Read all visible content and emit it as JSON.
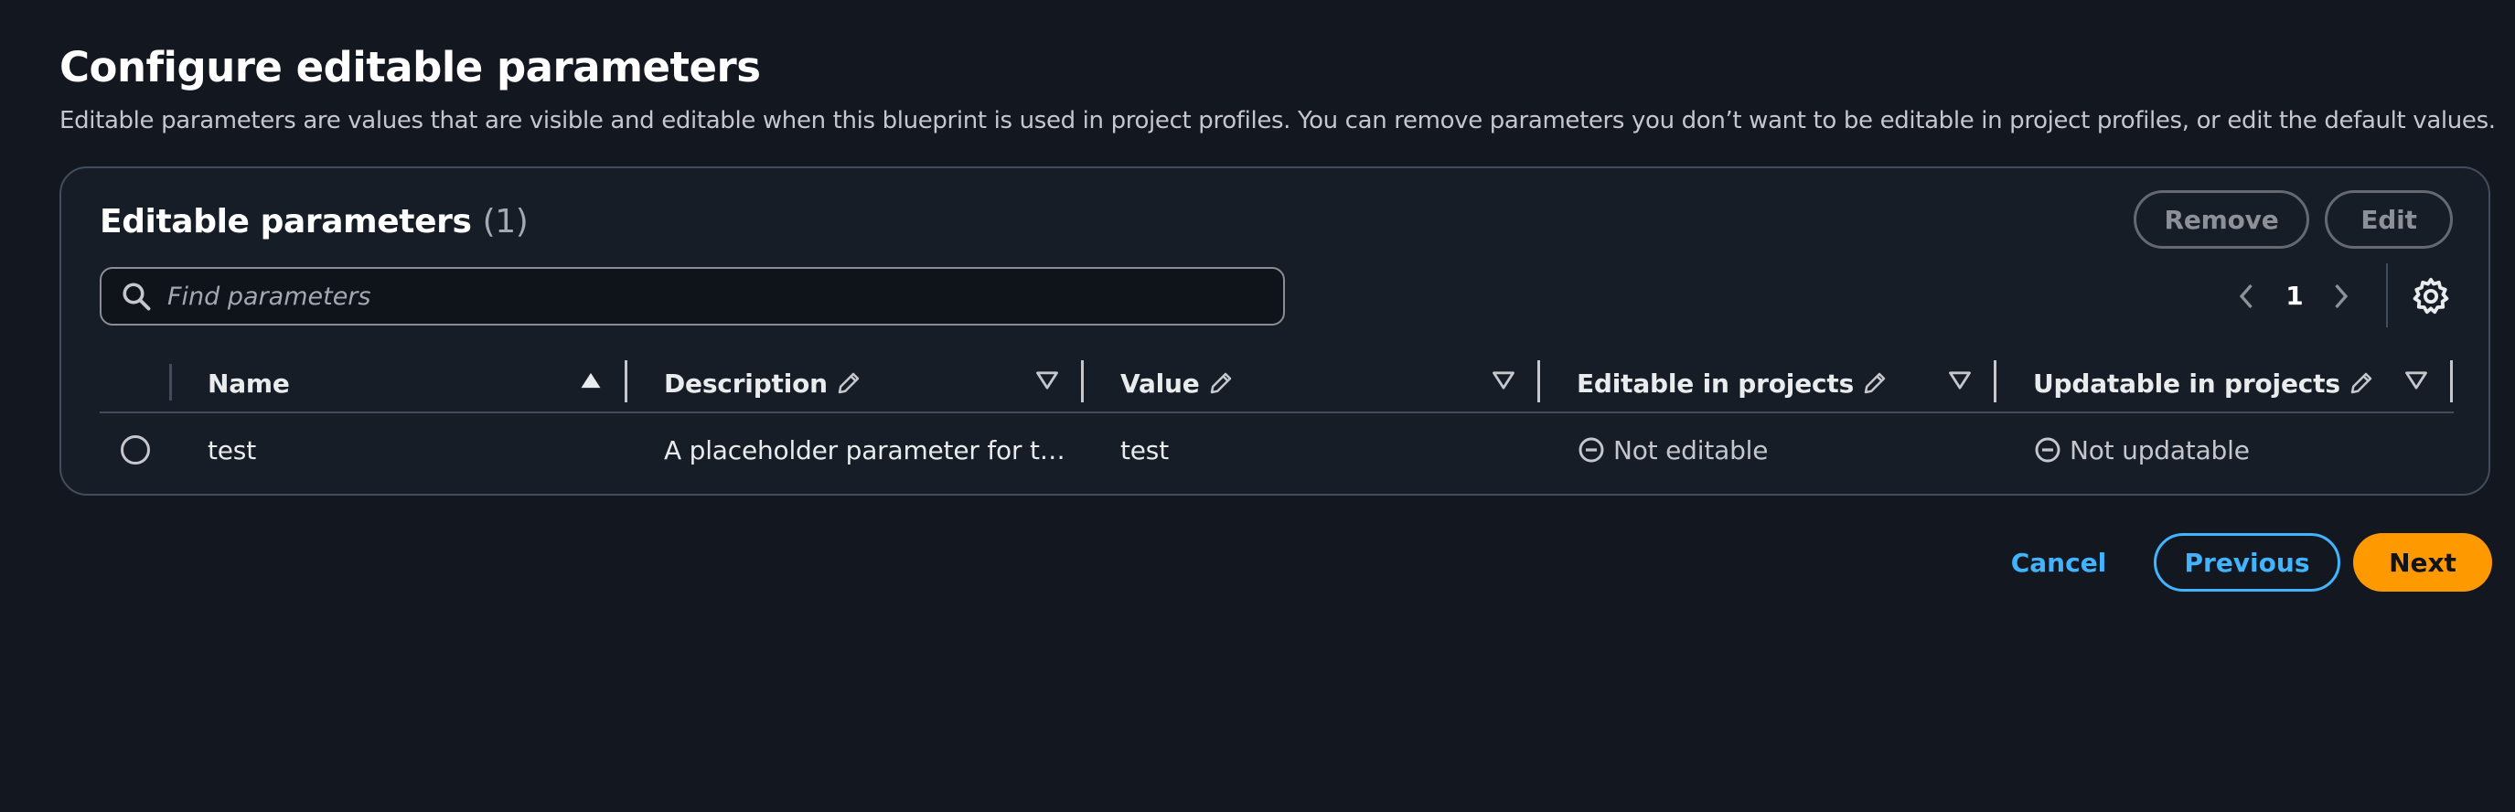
{
  "page": {
    "title": "Configure editable parameters",
    "description": "Editable parameters are values that are visible and editable when this blueprint is used in project profiles. You can remove parameters you don’t want to be editable in project profiles, or edit the default values."
  },
  "table": {
    "title": "Editable parameters",
    "count": "(1)",
    "remove_label": "Remove",
    "edit_label": "Edit",
    "search_placeholder": "Find parameters",
    "current_page": "1",
    "columns": {
      "name": "Name",
      "description": "Description",
      "value": "Value",
      "editable": "Editable in projects",
      "updatable": "Updatable in projects"
    },
    "rows": [
      {
        "name": "test",
        "description": "A placeholder parameter for t…",
        "value": "test",
        "editable": "Not editable",
        "updatable": "Not updatable"
      }
    ]
  },
  "footer": {
    "cancel_label": "Cancel",
    "previous_label": "Previous",
    "next_label": "Next"
  },
  "colors": {
    "background": "#131720",
    "container": "#161d26",
    "link": "#42b4ff",
    "primary": "#ff9900"
  },
  "icons": {
    "search": "search-icon",
    "prev": "chevron-left-icon",
    "next": "chevron-right-icon",
    "settings": "gear-icon",
    "edit_column": "pencil-icon",
    "sort": "sort-triangle-icon",
    "status": "minus-circle-icon"
  }
}
